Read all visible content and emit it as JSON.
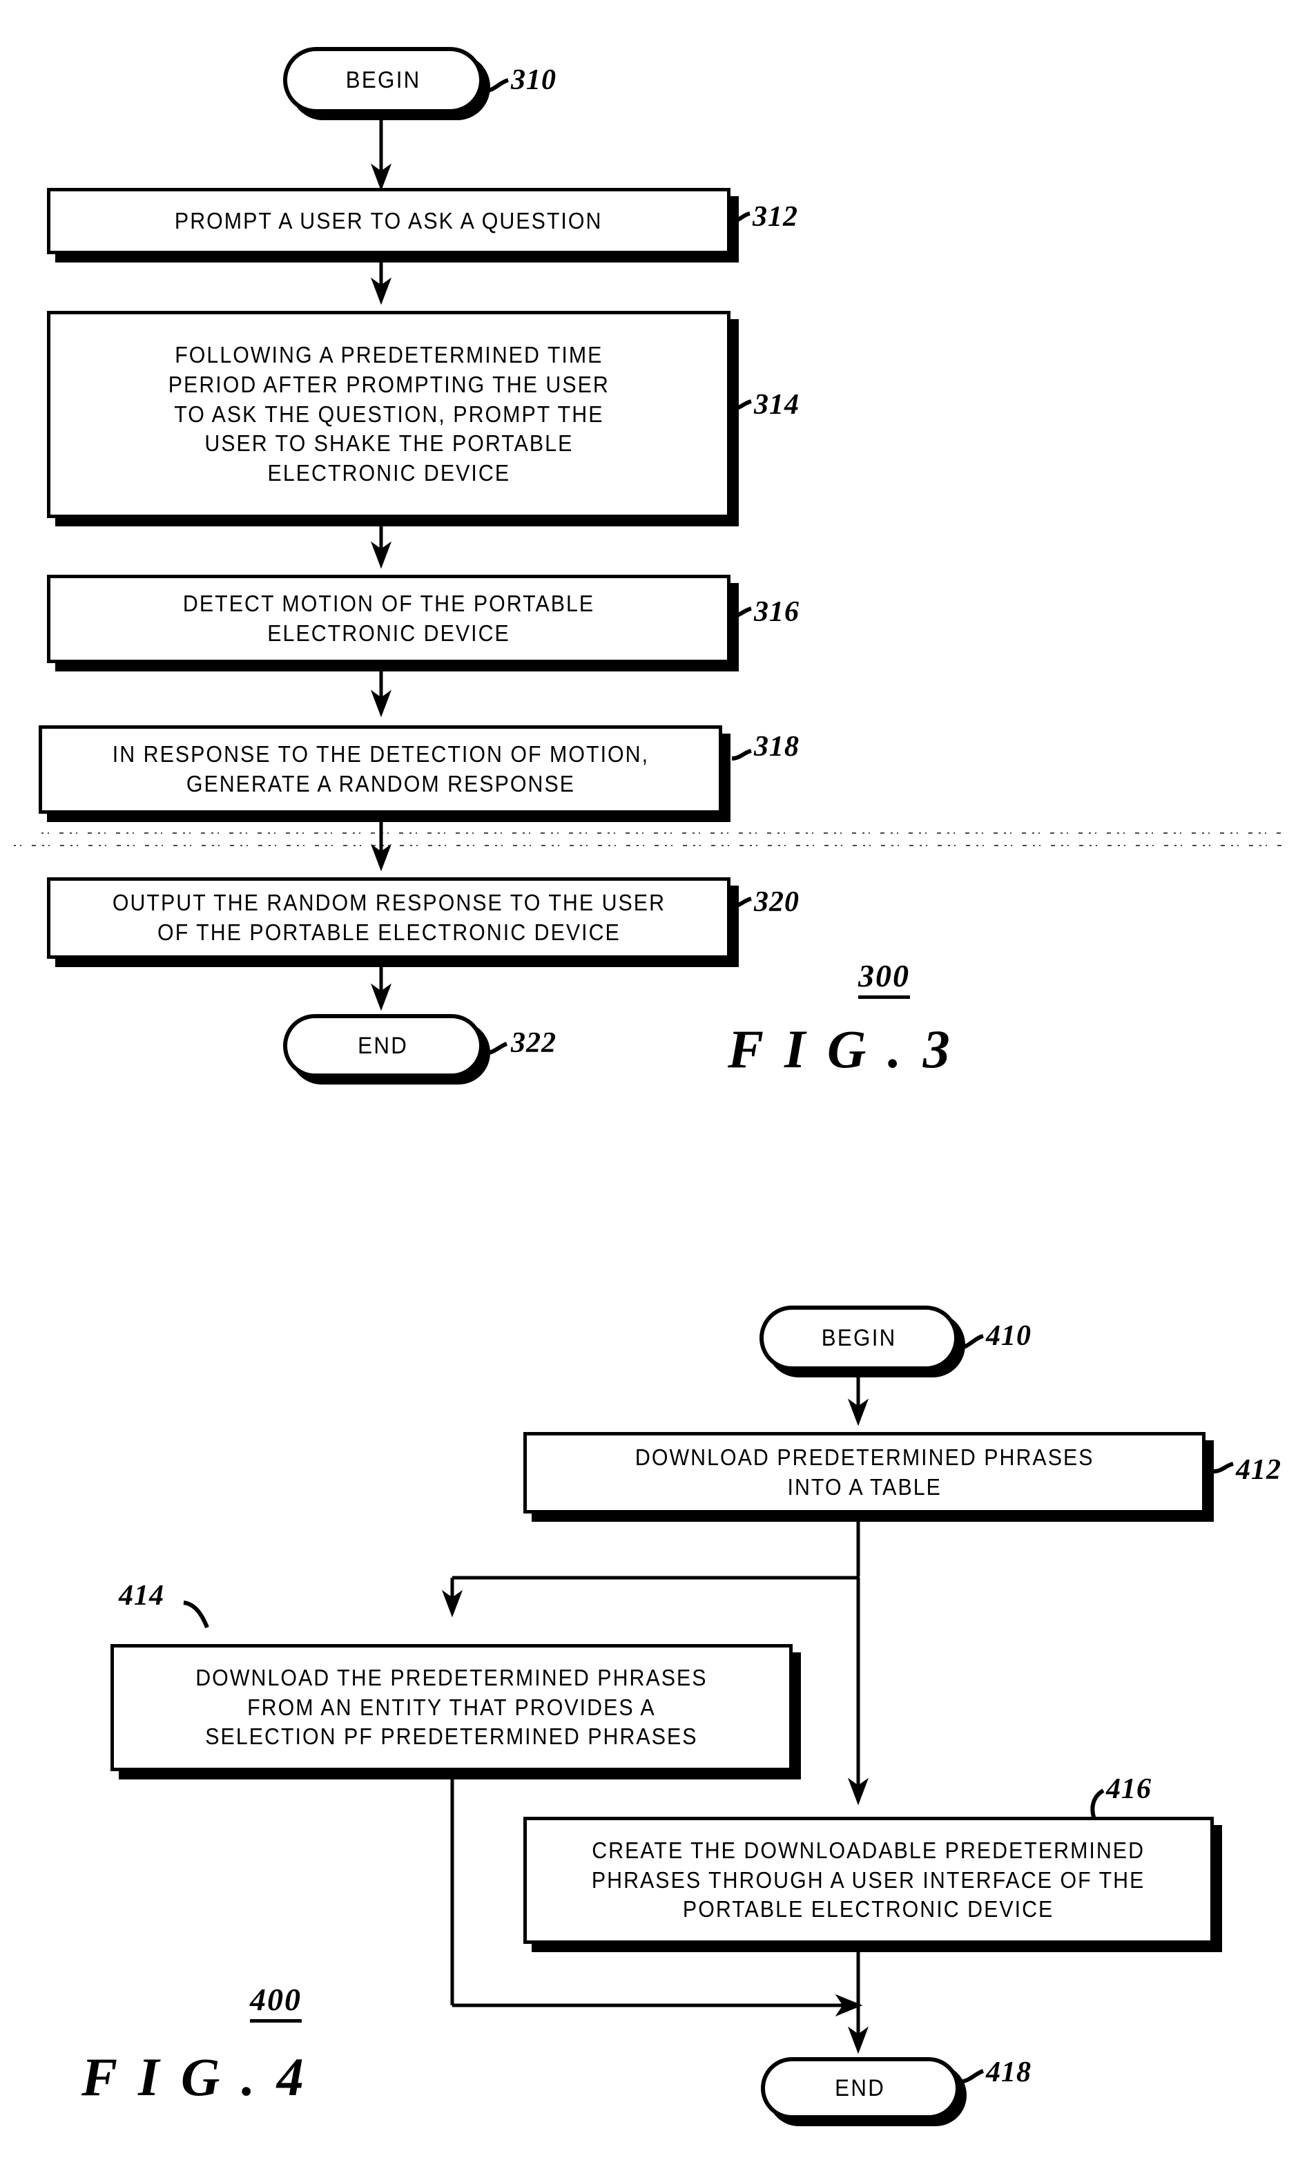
{
  "figures": [
    {
      "id": "fig3",
      "caption": "F I G .   3",
      "figure_number": "300",
      "nodes": [
        {
          "ref": "310",
          "type": "terminator",
          "label": "BEGIN"
        },
        {
          "ref": "312",
          "type": "process",
          "label": "PROMPT A USER TO ASK A QUESTION"
        },
        {
          "ref": "314",
          "type": "process",
          "label": "FOLLOWING A PREDETERMINED TIME\nPERIOD AFTER PROMPTING THE USER\nTO ASK THE QUESTION, PROMPT THE\nUSER TO SHAKE THE PORTABLE\nELECTRONIC DEVICE"
        },
        {
          "ref": "316",
          "type": "process",
          "label": "DETECT MOTION OF THE PORTABLE\nELECTRONIC DEVICE"
        },
        {
          "ref": "318",
          "type": "process",
          "label": "IN RESPONSE TO THE DETECTION OF MOTION,\nGENERATE A RANDOM RESPONSE"
        },
        {
          "ref": "320",
          "type": "process",
          "label": "OUTPUT THE RANDOM RESPONSE TO THE USER\nOF THE PORTABLE ELECTRONIC DEVICE"
        },
        {
          "ref": "322",
          "type": "terminator",
          "label": "END"
        }
      ]
    },
    {
      "id": "fig4",
      "caption": "F I G .   4",
      "figure_number": "400",
      "nodes": [
        {
          "ref": "410",
          "type": "terminator",
          "label": "BEGIN"
        },
        {
          "ref": "412",
          "type": "process",
          "label": "DOWNLOAD PREDETERMINED PHRASES\nINTO A TABLE"
        },
        {
          "ref": "414",
          "type": "process",
          "label": "DOWNLOAD THE PREDETERMINED PHRASES\nFROM AN ENTITY THAT PROVIDES A\nSELECTION PF PREDETERMINED PHRASES"
        },
        {
          "ref": "416",
          "type": "process",
          "label": "CREATE THE DOWNLOADABLE PREDETERMINED\nPHRASES THROUGH A USER INTERFACE OF THE\nPORTABLE ELECTRONIC DEVICE"
        },
        {
          "ref": "418",
          "type": "terminator",
          "label": "END"
        }
      ]
    }
  ],
  "colors": {
    "ink": "#000000",
    "paper": "#ffffff"
  }
}
